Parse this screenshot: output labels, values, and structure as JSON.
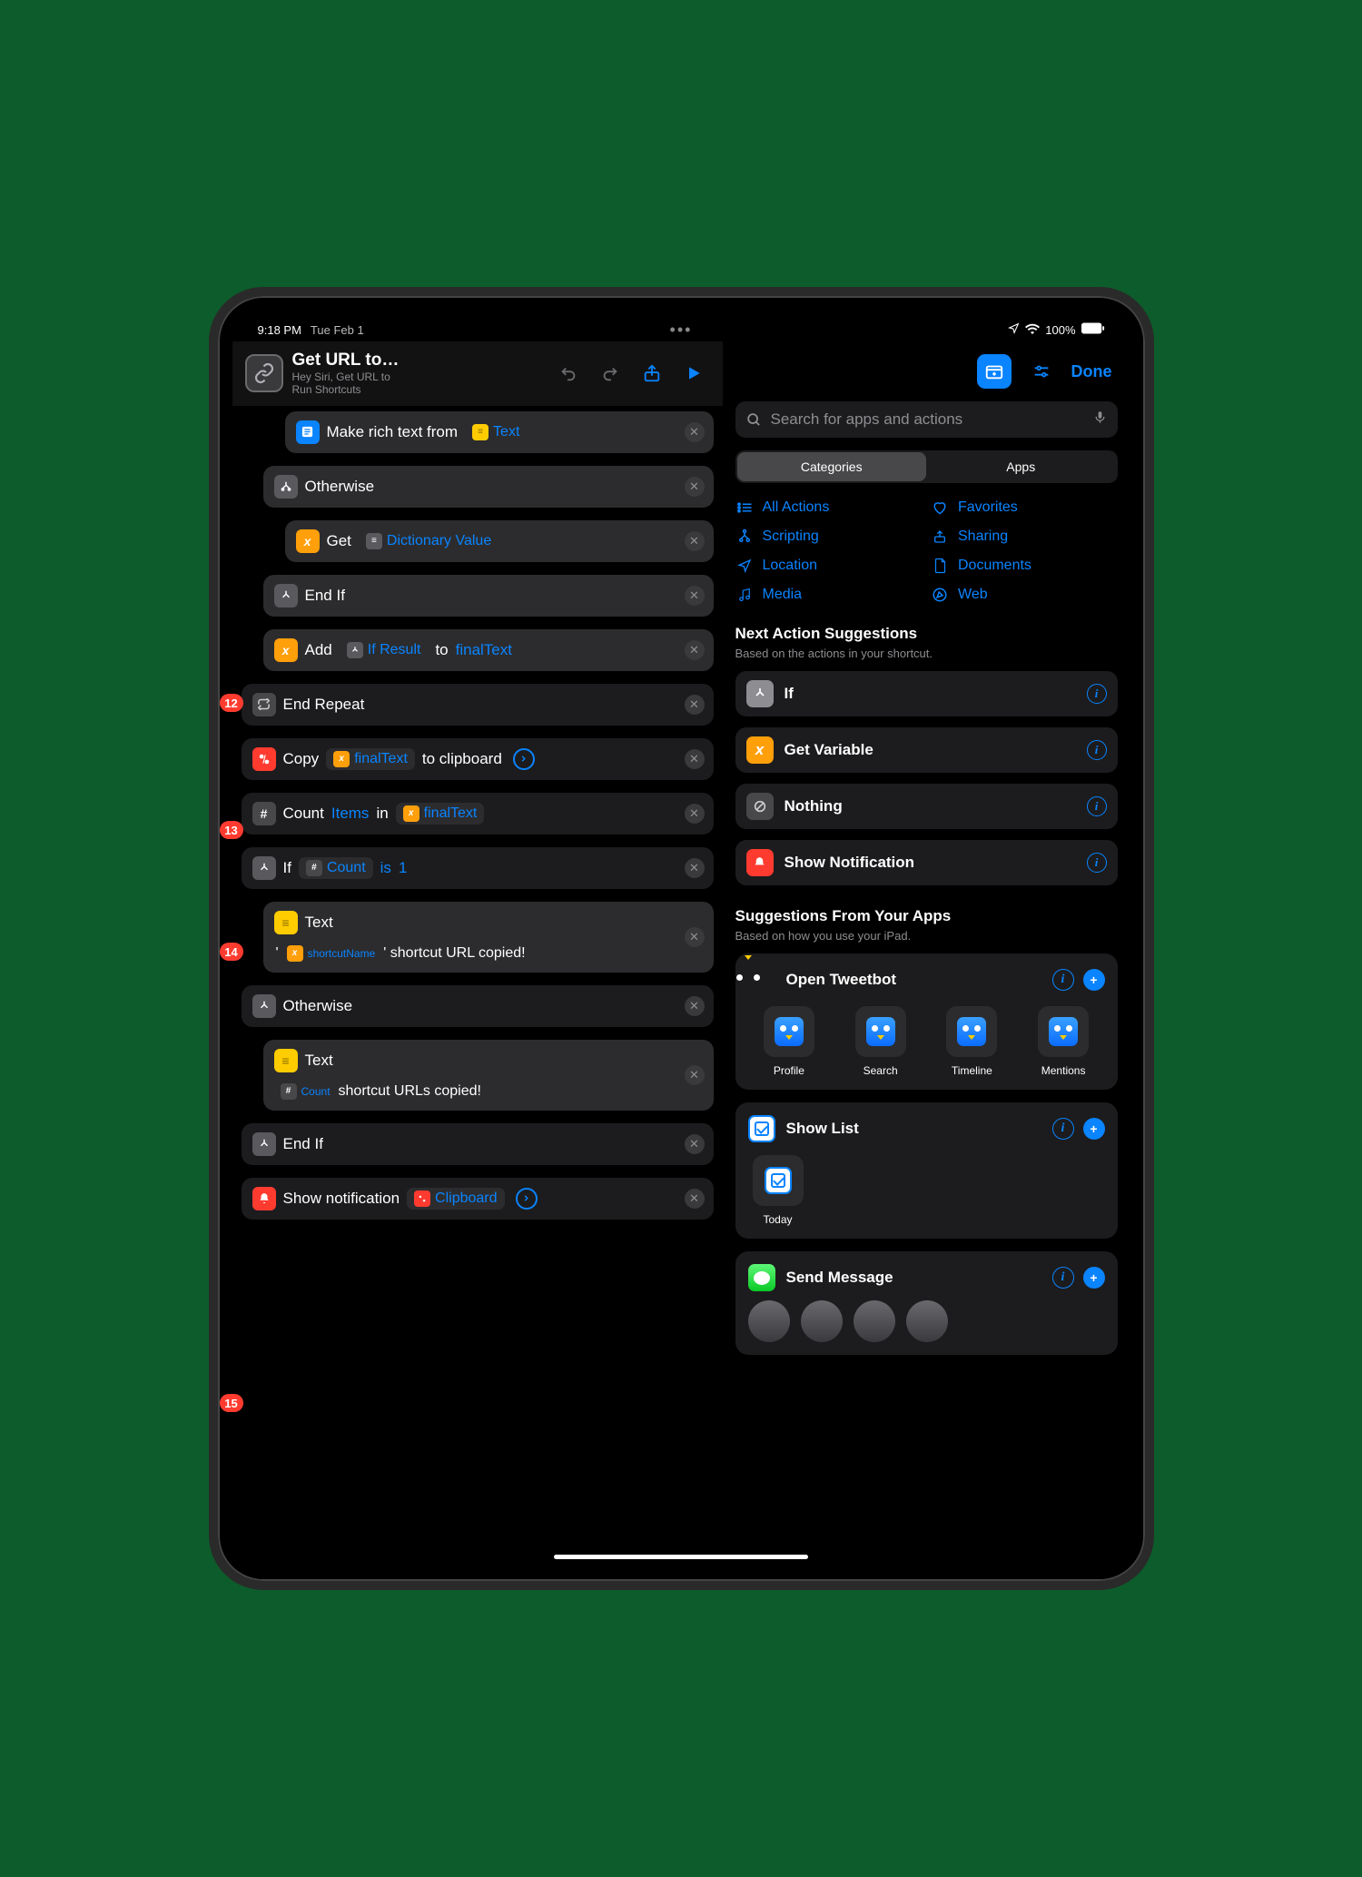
{
  "statusbar": {
    "time": "9:18 PM",
    "date": "Tue Feb 1",
    "battery": "100%"
  },
  "header": {
    "title": "Get URL to…",
    "subtitle1": "Hey Siri, Get URL to",
    "subtitle2": "Run Shortcuts"
  },
  "annotations": {
    "a12": "12",
    "a13": "13",
    "a14": "14",
    "a15": "15"
  },
  "actions": {
    "richtext": {
      "label": "Make rich text from",
      "token": "Text"
    },
    "otherwise1": "Otherwise",
    "get": {
      "label": "Get",
      "token": "Dictionary Value"
    },
    "endif1": "End If",
    "add": {
      "label": "Add",
      "token": "If Result",
      "to": "to",
      "var": "finalText"
    },
    "endrepeat": "End Repeat",
    "copy": {
      "label": "Copy",
      "token": "finalText",
      "tail": "to clipboard"
    },
    "count": {
      "label": "Count",
      "items": "Items",
      "in": "in",
      "var": "finalText"
    },
    "if": {
      "label": "If",
      "token": "Count",
      "is": "is",
      "val": "1"
    },
    "text1": {
      "label": "Text",
      "pre": "'",
      "token": "shortcutName",
      "post": "' shortcut URL copied!"
    },
    "otherwise2": "Otherwise",
    "text2": {
      "label": "Text",
      "token": "Count",
      "post": "shortcut URLs copied!"
    },
    "endif2": "End If",
    "notif": {
      "label": "Show notification",
      "token": "Clipboard"
    }
  },
  "right": {
    "done": "Done",
    "search_placeholder": "Search for apps and actions",
    "seg": {
      "categories": "Categories",
      "apps": "Apps"
    },
    "cats": {
      "all": "All Actions",
      "fav": "Favorites",
      "scripting": "Scripting",
      "sharing": "Sharing",
      "location": "Location",
      "documents": "Documents",
      "media": "Media",
      "web": "Web"
    },
    "next": {
      "title": "Next Action Suggestions",
      "sub": "Based on the actions in your shortcut.",
      "if": "If",
      "getvar": "Get Variable",
      "nothing": "Nothing",
      "shownotif": "Show Notification"
    },
    "apps": {
      "title": "Suggestions From Your Apps",
      "sub": "Based on how you use your iPad.",
      "tweetbot": {
        "title": "Open Tweetbot",
        "profile": "Profile",
        "search": "Search",
        "timeline": "Timeline",
        "mentions": "Mentions"
      },
      "things": {
        "title": "Show List",
        "today": "Today"
      },
      "messages": {
        "title": "Send Message"
      }
    }
  }
}
